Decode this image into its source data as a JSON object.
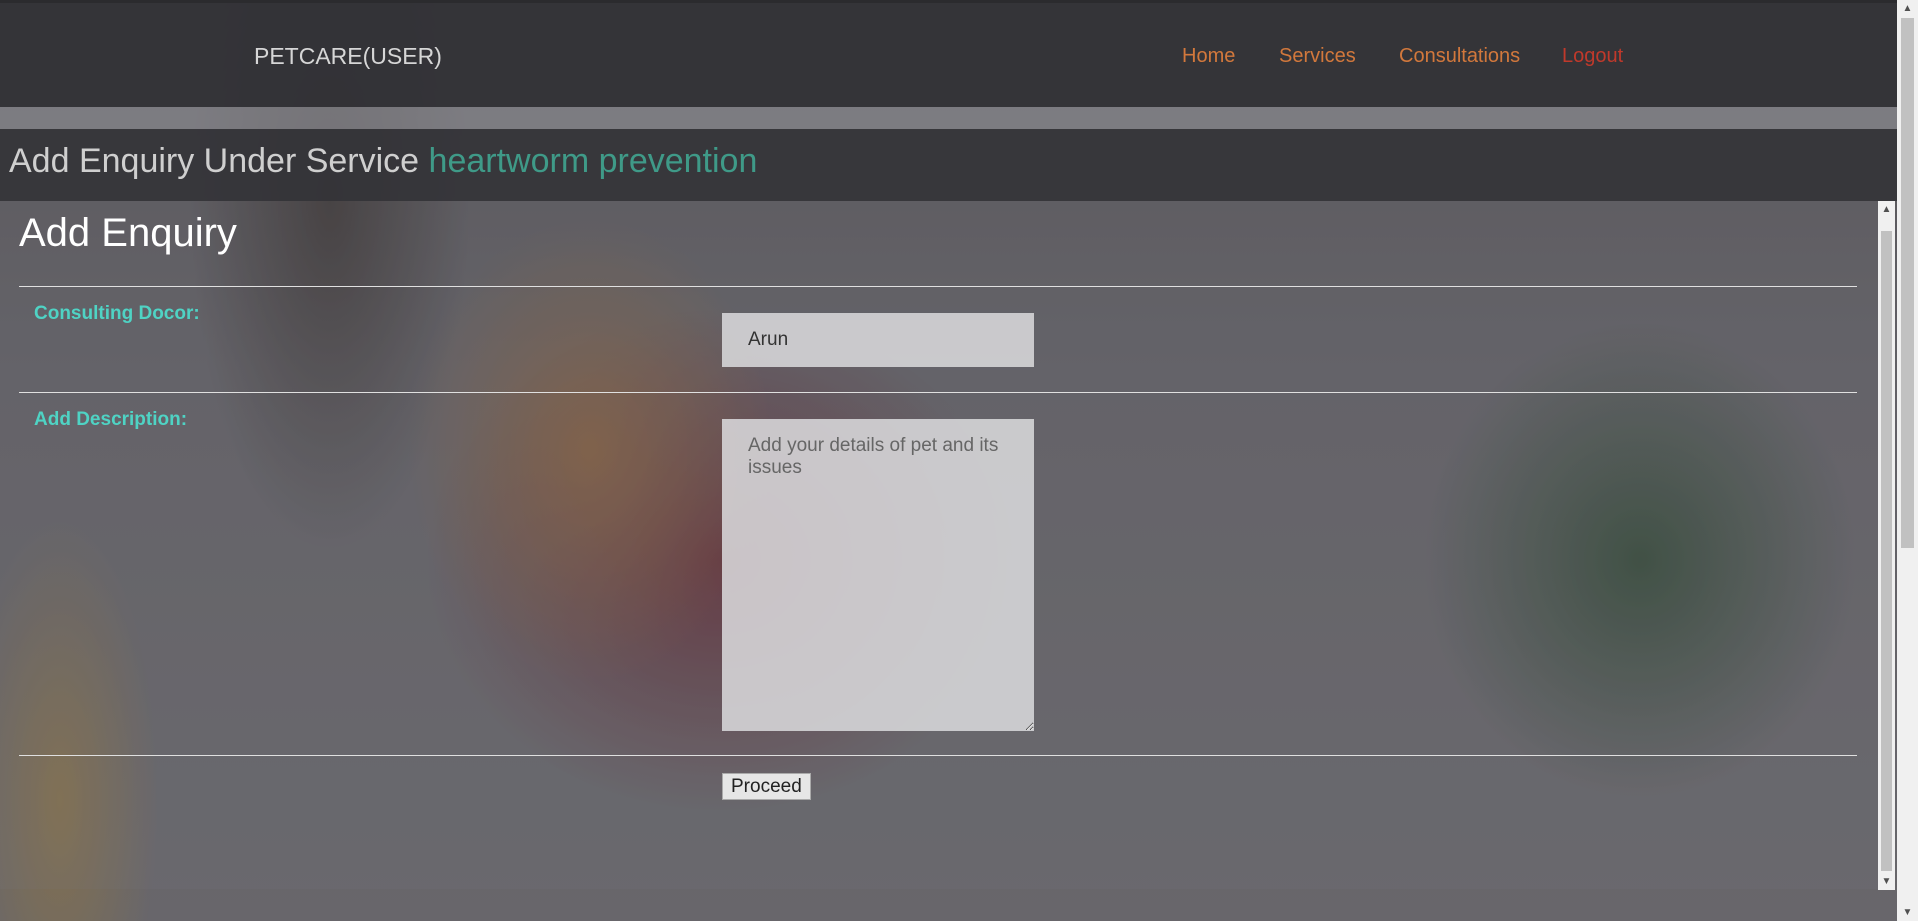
{
  "brand": "PETCARE(USER)",
  "nav": {
    "home": "Home",
    "services": "Services",
    "consultations": "Consultations",
    "logout": "Logout"
  },
  "header": {
    "prefix": "Add Enquiry Under Service",
    "service": "heartworm prevention"
  },
  "form": {
    "title": "Add Enquiry",
    "doctor_label": "Consulting Docor:",
    "doctor_value": "Arun",
    "description_label": "Add Description:",
    "description_placeholder": "Add your details of pet and its issues",
    "submit_label": "Proceed"
  },
  "colors": {
    "nav_link": "#d2783c",
    "logout": "#c0392b",
    "service_highlight": "#3f9a88",
    "label": "#4fd3c4"
  }
}
